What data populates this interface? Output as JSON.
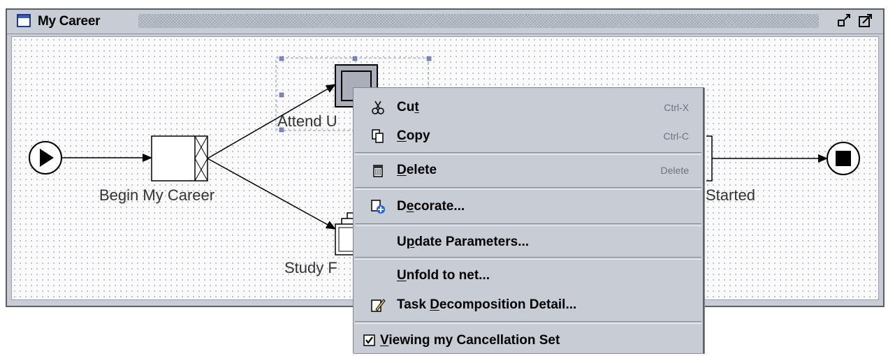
{
  "window": {
    "title": "My Career"
  },
  "nodes": {
    "begin": "Begin My Career",
    "attend": "Attend U",
    "study": "Study F",
    "started": "Started"
  },
  "context_menu": {
    "items": [
      {
        "icon": "scissors-icon",
        "label_pre": "Cu",
        "label_u": "t",
        "label_post": "",
        "shortcut": "Ctrl-X"
      },
      {
        "icon": "copy-icon",
        "label_pre": "",
        "label_u": "C",
        "label_post": "opy",
        "shortcut": "Ctrl-C"
      },
      {
        "icon": "trash-icon",
        "label_pre": "",
        "label_u": "D",
        "label_post": "elete",
        "shortcut": "Delete"
      },
      {
        "icon": "decorate-icon",
        "label_pre": "D",
        "label_u": "e",
        "label_post": "corate...",
        "shortcut": ""
      },
      {
        "icon": "",
        "label_pre": "U",
        "label_u": "p",
        "label_post": "date Parameters...",
        "shortcut": ""
      },
      {
        "icon": "",
        "label_pre": "",
        "label_u": "U",
        "label_post": "nfold to net...",
        "shortcut": ""
      },
      {
        "icon": "pencil-icon",
        "label_pre": "Task ",
        "label_u": "D",
        "label_post": "ecomposition Detail...",
        "shortcut": ""
      },
      {
        "icon": "checkbox-icon",
        "label_pre": "",
        "label_u": "V",
        "label_post": "iewing my Cancellation Set",
        "shortcut": ""
      }
    ]
  }
}
